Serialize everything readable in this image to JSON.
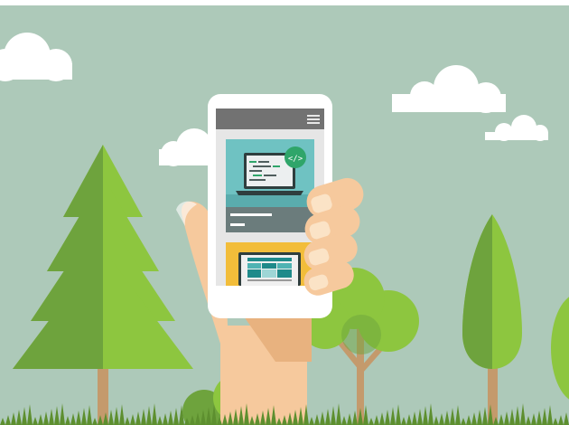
{
  "illustration": {
    "screen_content": {
      "code_badge_text": "</>",
      "menu_icon": "hamburger-menu-icon"
    }
  },
  "colors": {
    "sky": "#adc9b9",
    "cloud": "#ffffff",
    "tree_dark": "#6ea33d",
    "tree_light": "#8dc63f",
    "trunk": "#c49a6c",
    "skin": "#f6c99d",
    "phone": "#ffffff",
    "app_header": "#727272",
    "card_teal": "#6fc2c2",
    "card_yellow": "#f2bd3a",
    "badge_green": "#2fa56a",
    "grass": "#5d8f2f"
  }
}
